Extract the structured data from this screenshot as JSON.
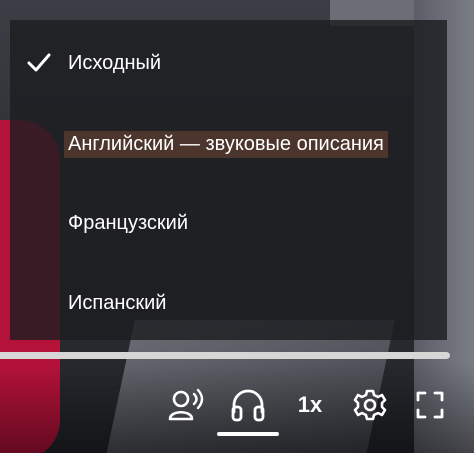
{
  "audio_menu": {
    "items": [
      {
        "label": "Исходный",
        "selected": true
      },
      {
        "label": "Английский — звуковые описания",
        "selected": false
      },
      {
        "label": "Французский",
        "selected": false
      },
      {
        "label": "Испанский",
        "selected": false
      }
    ]
  },
  "controls": {
    "playback_rate": "1x",
    "icons": [
      "audio-description-icon",
      "headphones-icon",
      "playback-rate",
      "gear-icon",
      "fullscreen-icon"
    ]
  },
  "colors": {
    "menu_bg": "#1c1d21",
    "highlight": "#5c3c30",
    "accent_underline": "#ffffff"
  }
}
